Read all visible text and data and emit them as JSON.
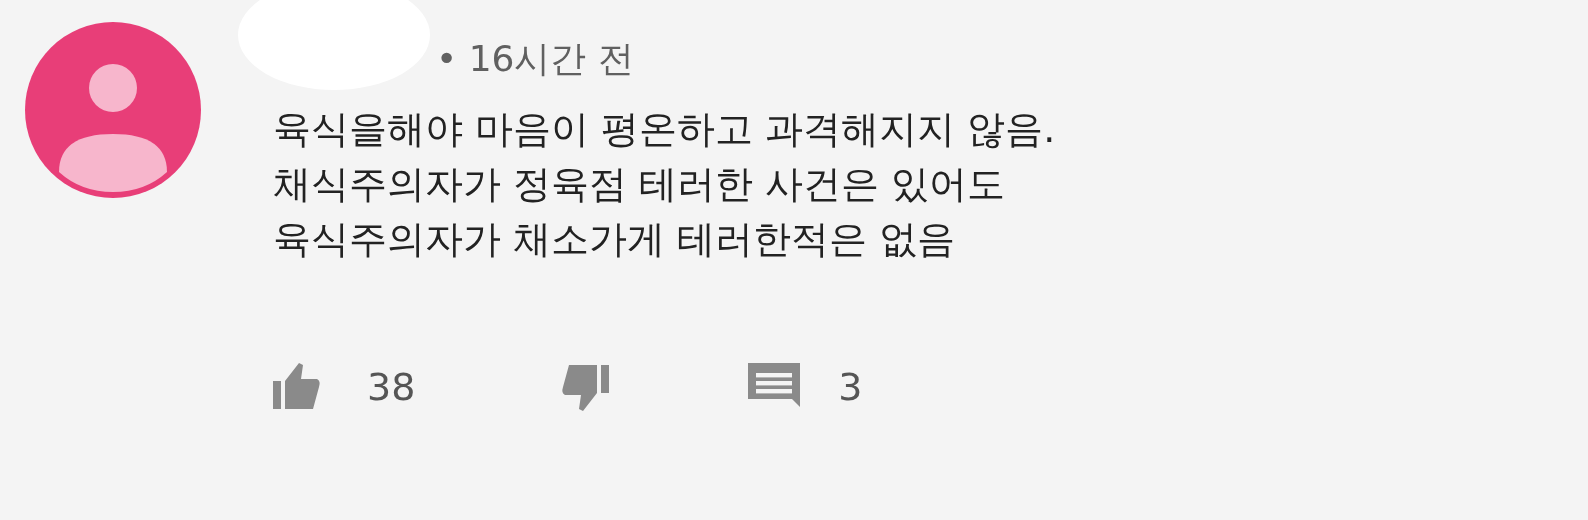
{
  "comment": {
    "time": "• 16시간 전",
    "lines": [
      "육식을해야 마음이 평온하고 과격해지지 않음.",
      "채식주의자가 정육점 테러한 사건은 있어도",
      "육식주의자가 채소가게 테러한적은 없음"
    ],
    "likes": "38",
    "replies": "3"
  }
}
